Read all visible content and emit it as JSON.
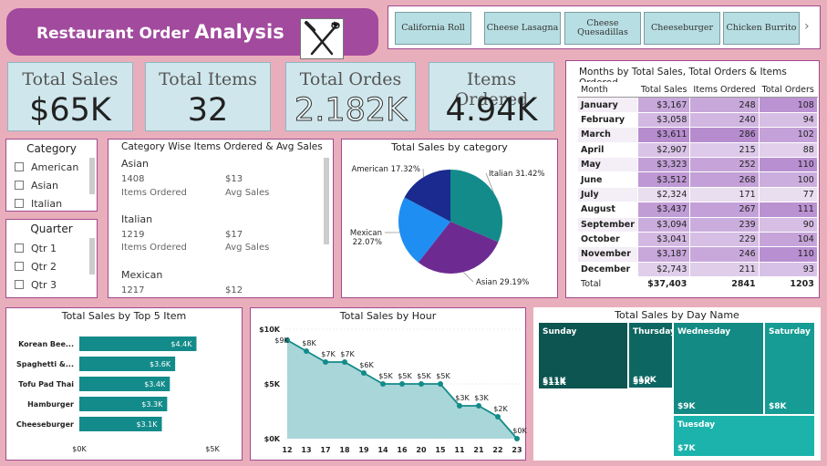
{
  "header": {
    "title_a": "Restaurant Order ",
    "title_b": "Analysis",
    "logo_icon": "fork-knife-icon"
  },
  "item_slicer": {
    "items": [
      "California Roll",
      "Cheese Lasagna",
      "Cheese Quesadillas",
      "Cheeseburger",
      "Chicken Burrito"
    ],
    "next_icon": "chevron-right-icon"
  },
  "kpis": [
    {
      "label": "Total Sales",
      "value": "$65K"
    },
    {
      "label": "Total Items",
      "value": "32"
    },
    {
      "label": "Total Ordes",
      "value": "2.182K"
    },
    {
      "label": "Items Ordered",
      "value": "4.94K"
    }
  ],
  "category_slicer": {
    "title": "Category",
    "options": [
      "American",
      "Asian",
      "Italian"
    ]
  },
  "quarter_slicer": {
    "title": "Quarter",
    "options": [
      "Qtr 1",
      "Qtr 2",
      "Qtr 3"
    ]
  },
  "cat_cards": {
    "title": "Category Wise Items Ordered & Avg Sales",
    "groups": [
      {
        "name": "Asian",
        "items": "1408",
        "avg": "$13",
        "items_label": "Items Ordered",
        "avg_label": "Avg Sales"
      },
      {
        "name": "Italian",
        "items": "1219",
        "avg": "$17",
        "items_label": "Items Ordered",
        "avg_label": "Avg Sales"
      },
      {
        "name": "Mexican",
        "items": "1217",
        "avg": "$12"
      }
    ]
  },
  "month_table": {
    "title": "Months by Total Sales, Total Orders & Items Ordered",
    "headers": [
      "Month",
      "Total Sales",
      "Items Ordered",
      "Total Orders"
    ],
    "rows": [
      [
        "January",
        "$3,167",
        "248",
        "108"
      ],
      [
        "February",
        "$3,058",
        "240",
        "94"
      ],
      [
        "March",
        "$3,611",
        "286",
        "102"
      ],
      [
        "April",
        "$2,907",
        "215",
        "88"
      ],
      [
        "May",
        "$3,323",
        "252",
        "110"
      ],
      [
        "June",
        "$3,512",
        "268",
        "100"
      ],
      [
        "July",
        "$2,324",
        "171",
        "77"
      ],
      [
        "August",
        "$3,437",
        "267",
        "111"
      ],
      [
        "September",
        "$3,094",
        "239",
        "90"
      ],
      [
        "October",
        "$3,041",
        "229",
        "104"
      ],
      [
        "November",
        "$3,187",
        "246",
        "110"
      ],
      [
        "December",
        "$2,743",
        "211",
        "93"
      ]
    ],
    "total": [
      "Total",
      "$37,403",
      "2841",
      "1203"
    ],
    "shade_color": "#b98fcf"
  },
  "chart_data": [
    {
      "type": "pie",
      "title": "Total Sales by category",
      "slices": [
        {
          "label": "Italian",
          "value": 31.42,
          "display": "Italian 31.42%",
          "color": "#138b8a"
        },
        {
          "label": "Asian",
          "value": 29.19,
          "display": "Asian 29.19%",
          "color": "#6d2b91"
        },
        {
          "label": "Mexican",
          "value": 22.07,
          "display": "Mexican 22.07%",
          "color": "#1e8ef2"
        },
        {
          "label": "American",
          "value": 17.32,
          "display": "American 17.32%",
          "color": "#1a2a8e"
        }
      ]
    },
    {
      "type": "bar",
      "orientation": "horizontal",
      "title": "Total Sales by Top 5 Item",
      "categories": [
        "Korean Bee...",
        "Spaghetti &...",
        "Tofu Pad Thai",
        "Hamburger",
        "Cheeseburger"
      ],
      "values": [
        4.4,
        3.6,
        3.4,
        3.3,
        3.1
      ],
      "labels": [
        "$4.4K",
        "$3.6K",
        "$3.4K",
        "$3.3K",
        "$3.1K"
      ],
      "xlim": [
        0,
        5
      ],
      "xticks": [
        "$0K",
        "$5K"
      ],
      "color": "#138b8a"
    },
    {
      "type": "area",
      "title": "Total Sales by Hour",
      "x": [
        "12",
        "13",
        "17",
        "18",
        "19",
        "14",
        "16",
        "20",
        "15",
        "11",
        "21",
        "22",
        "23"
      ],
      "values": [
        9,
        8,
        7,
        7,
        6,
        5,
        5,
        5,
        5,
        3,
        3,
        2,
        0
      ],
      "labels": [
        "$9K",
        "$8K",
        "$7K",
        "$7K",
        "$6K",
        "$5K",
        "$5K",
        "$5K",
        "$5K",
        "$3K",
        "$3K",
        "$2K",
        "$0K"
      ],
      "ylim": [
        0,
        10
      ],
      "yticks": [
        "$0K",
        "$5K",
        "$10K"
      ],
      "line_color": "#138b8a",
      "fill_color": "#a9d6d8"
    },
    {
      "type": "treemap",
      "title": "Total Sales by Day Name",
      "cells": [
        {
          "label": "Sunday",
          "value": "$11K",
          "color": "#0c5550"
        },
        {
          "label": "Friday",
          "value": "$11K",
          "color": "#0c5550"
        },
        {
          "label": "Thursday",
          "value": "$10K",
          "color": "#0d6661"
        },
        {
          "label": "Monday",
          "value": "$9K",
          "color": "#0e6e69"
        },
        {
          "label": "Wednesday",
          "value": "$9K",
          "color": "#138b84"
        },
        {
          "label": "Saturday",
          "value": "$8K",
          "color": "#169c94"
        },
        {
          "label": "Tuesday",
          "value": "$7K",
          "color": "#1bb3ab"
        }
      ]
    }
  ]
}
